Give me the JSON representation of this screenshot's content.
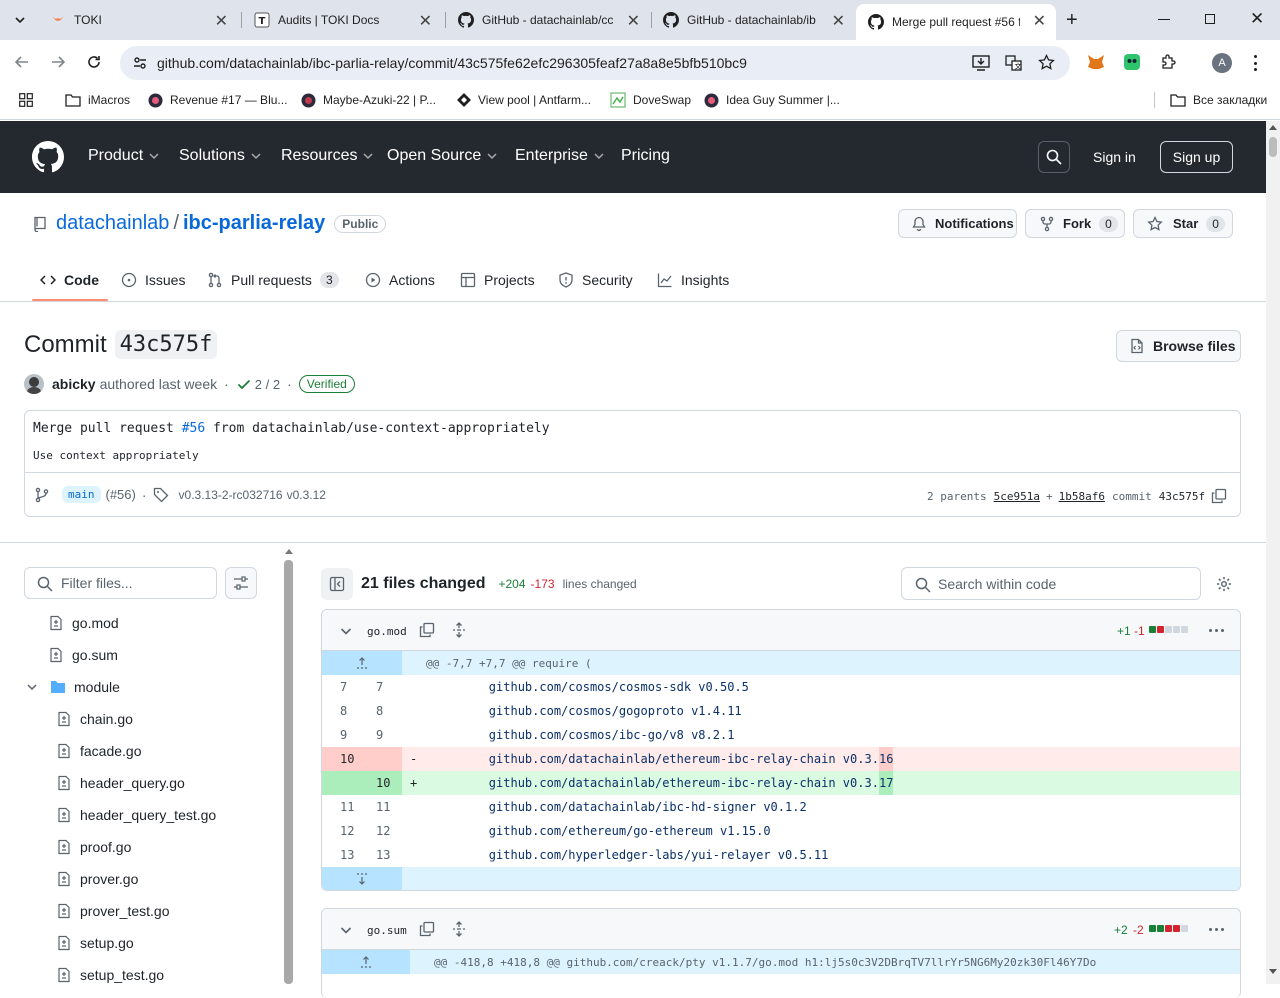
{
  "browser": {
    "tabs": [
      {
        "label": "TOKI",
        "icon": "toki-icon"
      },
      {
        "label": "Audits | TOKI Docs",
        "icon": "toki-docs-icon"
      },
      {
        "label": "GitHub - datachainlab/cc",
        "icon": "github-icon"
      },
      {
        "label": "GitHub - datachainlab/ib",
        "icon": "github-icon"
      },
      {
        "label": "Merge pull request #56 f",
        "icon": "github-icon"
      }
    ],
    "url": "github.com/datachainlab/ibc-parlia-relay/commit/43c575fe62efc296305feaf27a8a8e5bfb510bc9",
    "bookmarks": [
      "iMacros",
      "Revenue #17 — Blu...",
      "Maybe-Azuki-22 | P...",
      "View pool | Antfarm...",
      "DoveSwap",
      "Idea Guy Summer |..."
    ],
    "all_bookmarks": "Все закладки",
    "profile_initial": "A"
  },
  "gh_nav": {
    "items": [
      "Product",
      "Solutions",
      "Resources",
      "Open Source",
      "Enterprise",
      "Pricing"
    ],
    "sign_in": "Sign in",
    "sign_up": "Sign up"
  },
  "repo": {
    "owner": "datachainlab",
    "separator": "/",
    "name": "ibc-parlia-relay",
    "visibility": "Public",
    "notifications": "Notifications",
    "fork": "Fork",
    "fork_count": "0",
    "star": "Star",
    "star_count": "0",
    "tabs": [
      {
        "label": "Code"
      },
      {
        "label": "Issues"
      },
      {
        "label": "Pull requests",
        "count": "3"
      },
      {
        "label": "Actions"
      },
      {
        "label": "Projects"
      },
      {
        "label": "Security"
      },
      {
        "label": "Insights"
      }
    ]
  },
  "commit": {
    "title_prefix": "Commit",
    "sha_short": "43c575f",
    "browse_files": "Browse files",
    "author": "abicky",
    "authored": "authored last week",
    "dot": "·",
    "checks": "2 / 2",
    "verified": "Verified",
    "message_prefix": "Merge pull request",
    "pr_link": "#56",
    "message_suffix": "from datachainlab/use-context-appropriately",
    "body": "Use context appropriately",
    "branch": "main",
    "pr_ref": "(#56)",
    "tags": "v0.3.13-2-rc032716",
    "tag2": "v0.3.12",
    "parents_label": "2 parents",
    "parent1": "5ce951a",
    "plus": "+",
    "parent2": "1b58af6",
    "commit_label": "commit",
    "commit_sha": "43c575f"
  },
  "sidebar": {
    "filter_placeholder": "Filter files...",
    "files": [
      "go.mod",
      "go.sum"
    ],
    "folder": "module",
    "module_files": [
      "chain.go",
      "facade.go",
      "header_query.go",
      "header_query_test.go",
      "proof.go",
      "prover.go",
      "prover_test.go",
      "setup.go",
      "setup_test.go"
    ]
  },
  "diff_summary": {
    "files_changed": "21 files changed",
    "additions": "+204",
    "deletions": "-173",
    "lines_changed": "lines changed",
    "search_placeholder": "Search within code"
  },
  "diffs": [
    {
      "file": "go.mod",
      "additions": "+1",
      "deletions": "-1",
      "hunk": "@@ -7,7 +7,7 @@ require (",
      "lines": [
        {
          "old": "7",
          "new": "7",
          "sign": "",
          "text": "\tgithub.com/cosmos/cosmos-sdk v0.50.5",
          "type": "ctx"
        },
        {
          "old": "8",
          "new": "8",
          "sign": "",
          "text": "\tgithub.com/cosmos/gogoproto v1.4.11",
          "type": "ctx"
        },
        {
          "old": "9",
          "new": "9",
          "sign": "",
          "text": "\tgithub.com/cosmos/ibc-go/v8 v8.2.1",
          "type": "ctx"
        },
        {
          "old": "10",
          "new": "",
          "sign": "-",
          "text": "\tgithub.com/datachainlab/ethereum-ibc-relay-chain v0.3.",
          "hl": "16",
          "type": "del"
        },
        {
          "old": "",
          "new": "10",
          "sign": "+",
          "text": "\tgithub.com/datachainlab/ethereum-ibc-relay-chain v0.3.",
          "hl": "17",
          "type": "add"
        },
        {
          "old": "11",
          "new": "11",
          "sign": "",
          "text": "\tgithub.com/datachainlab/ibc-hd-signer v0.1.2",
          "type": "ctx"
        },
        {
          "old": "12",
          "new": "12",
          "sign": "",
          "text": "\tgithub.com/ethereum/go-ethereum v1.15.0",
          "type": "ctx"
        },
        {
          "old": "13",
          "new": "13",
          "sign": "",
          "text": "\tgithub.com/hyperledger-labs/yui-relayer v0.5.11",
          "type": "ctx"
        }
      ]
    },
    {
      "file": "go.sum",
      "additions": "+2",
      "deletions": "-2",
      "hunk": "@@ -418,8 +418,8 @@ github.com/creack/pty v1.1.7/go.mod h1:lj5s0c3V2DBrqTV7llrYr5NG6My20zk30Fl46Y7Do"
    }
  ],
  "colors": {
    "gh_header": "#24292f",
    "link": "#0969da",
    "add_bg": "#dafbe1",
    "del_bg": "#ffebe9",
    "hunk_bg": "#ddf4ff",
    "verified": "#1a7f37"
  }
}
